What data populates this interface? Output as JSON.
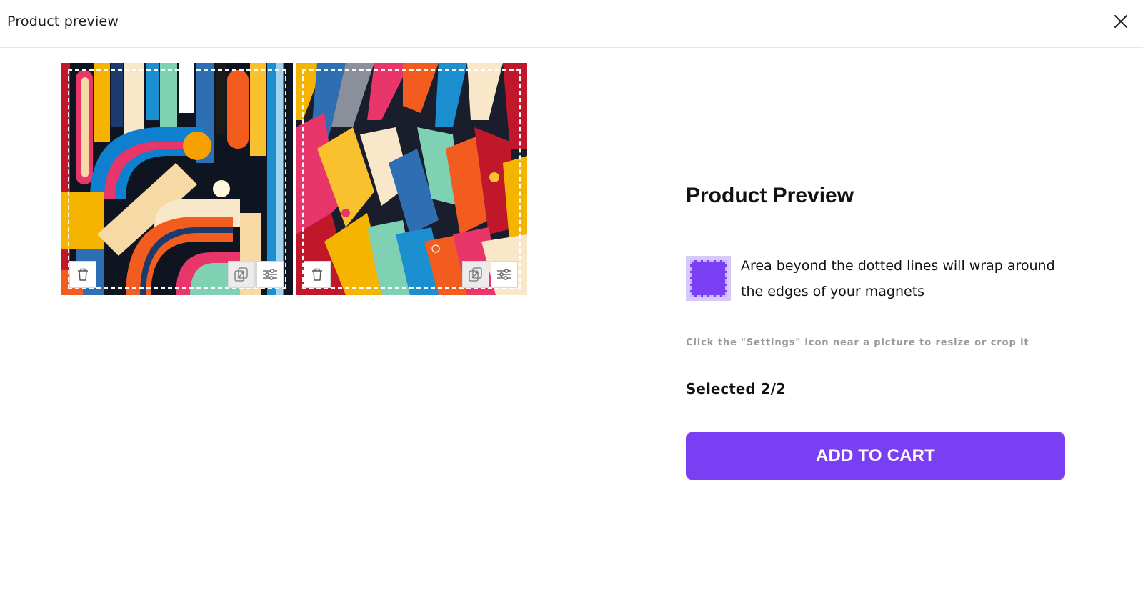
{
  "header": {
    "title": "Product preview",
    "close_icon": "close-icon"
  },
  "magnets": [
    {
      "name": "magnet-1",
      "actions": [
        "trash-icon",
        "replace-image-icon",
        "settings-sliders-icon"
      ]
    },
    {
      "name": "magnet-2",
      "actions": [
        "trash-icon",
        "replace-image-icon",
        "settings-sliders-icon"
      ]
    }
  ],
  "side": {
    "heading": "Product Preview",
    "wrap_note": "Area beyond the dotted lines will wrap around the edges of your magnets",
    "settings_hint": "Click the \"Settings\" icon near a picture to resize or crop it",
    "selected_text": "Selected 2/2",
    "cart_button": "ADD TO CART"
  },
  "colors": {
    "accent": "#7a3ff2",
    "swatch_bg": "#d8c8fb",
    "hint": "#9a9a9a"
  }
}
